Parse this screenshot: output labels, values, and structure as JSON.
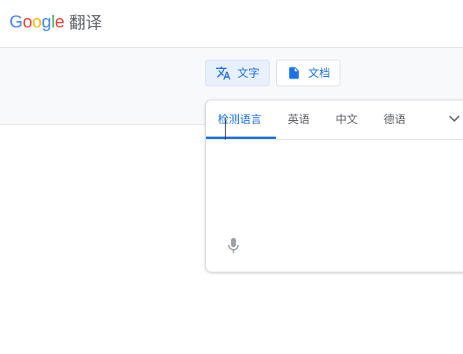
{
  "header": {
    "logo_letters": [
      {
        "char": "G",
        "color": "#4285F4"
      },
      {
        "char": "o",
        "color": "#EA4335"
      },
      {
        "char": "o",
        "color": "#FBBC05"
      },
      {
        "char": "g",
        "color": "#4285F4"
      },
      {
        "char": "l",
        "color": "#34A853"
      },
      {
        "char": "e",
        "color": "#EA4335"
      }
    ],
    "product_name": "翻译"
  },
  "modes": {
    "text_label": "文字",
    "text_icon": "translate-icon",
    "doc_label": "文档",
    "doc_icon": "document-icon",
    "active": "text"
  },
  "source": {
    "tabs": [
      "检测语言",
      "英语",
      "中文",
      "德语"
    ],
    "active_tab": "检测语言",
    "expand_icon": "chevron-down-icon",
    "input_value": "",
    "mic_icon": "microphone-icon"
  },
  "colors": {
    "accent": "#1a73e8",
    "active_mode_bg": "#e8f0fe",
    "tab_text": "#5f6368",
    "mode_bar_bg": "#f8f9fa"
  }
}
